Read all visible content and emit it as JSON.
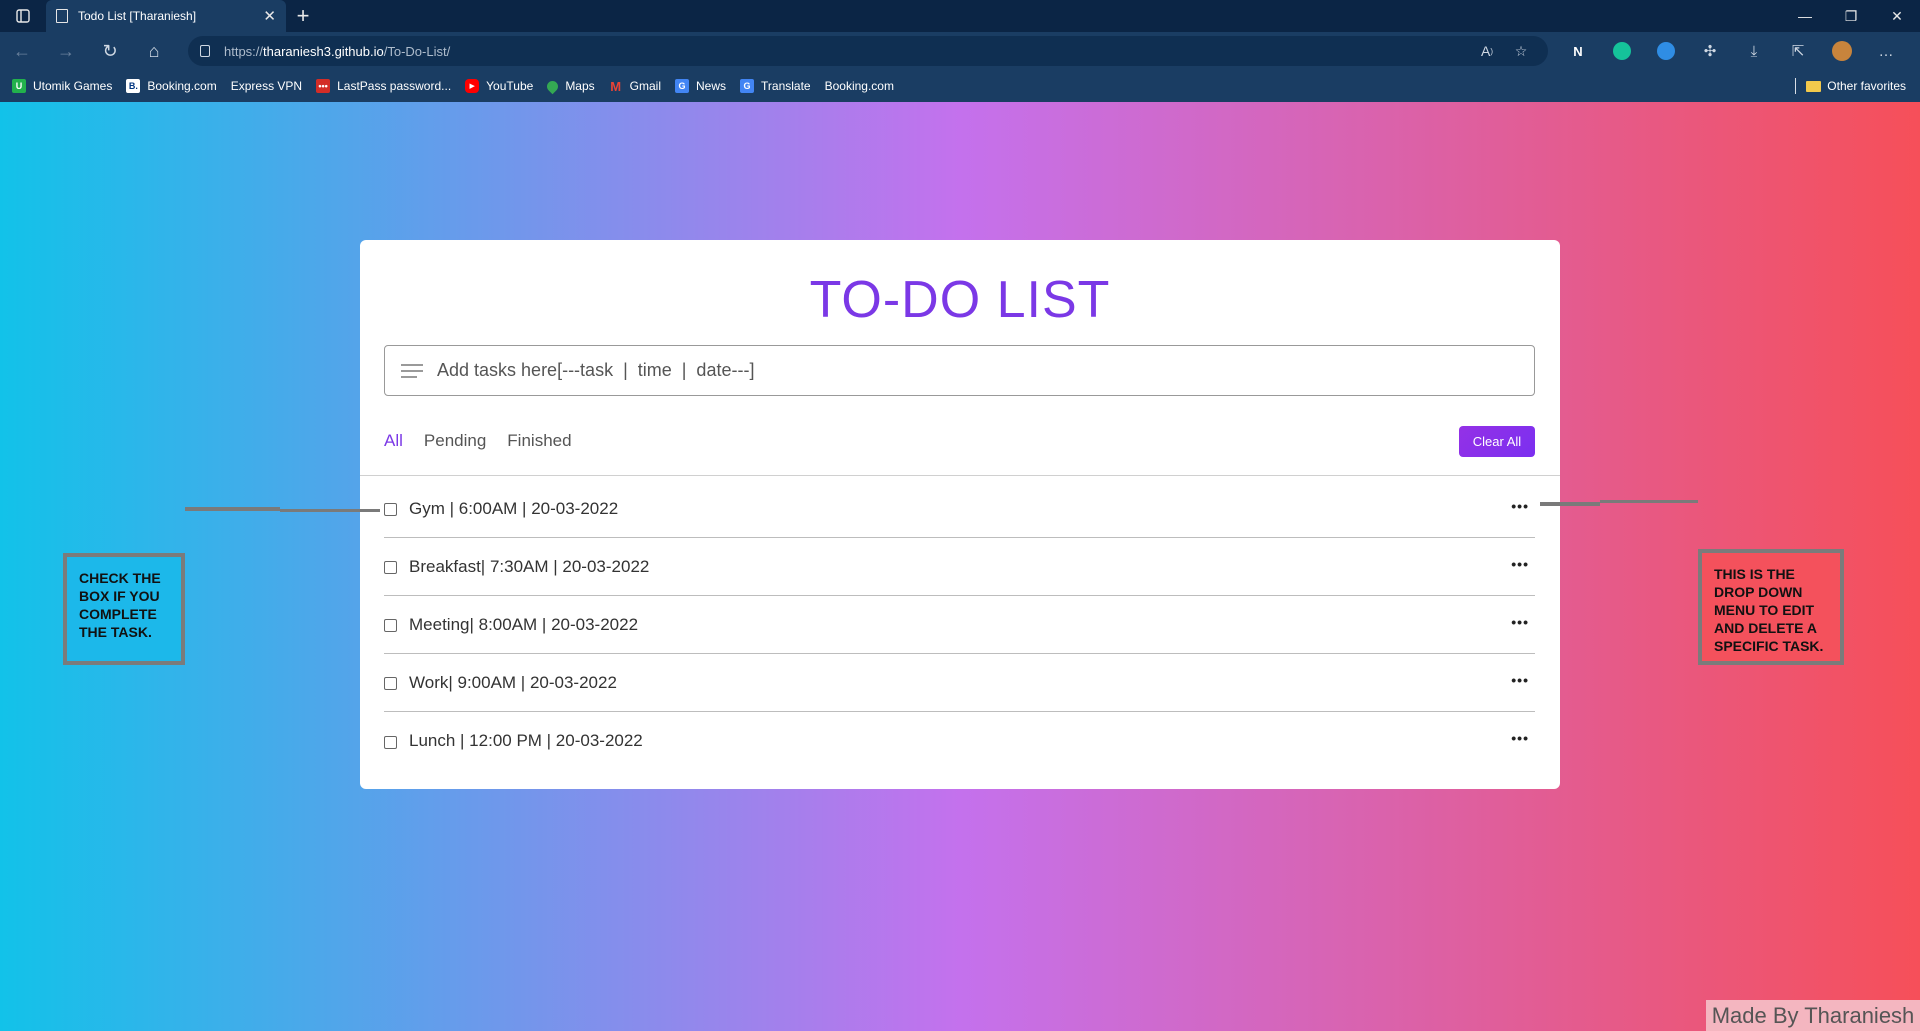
{
  "browser": {
    "tab_title": "Todo List [Tharaniesh]",
    "url_scheme": "https://",
    "url_host": "tharaniesh3.github.io",
    "url_path": "/To-Do-List/",
    "favorites": [
      {
        "label": "Utomik Games",
        "icon": "utomik-icon",
        "color": "#22b14c"
      },
      {
        "label": "Booking.com",
        "icon": "booking-icon",
        "color": "#003580"
      },
      {
        "label": "Express VPN",
        "icon": "page-icon",
        "color": ""
      },
      {
        "label": "LastPass password...",
        "icon": "lastpass-icon",
        "color": "#d32d27"
      },
      {
        "label": "YouTube",
        "icon": "youtube-icon",
        "color": "#ff0000"
      },
      {
        "label": "Maps",
        "icon": "maps-icon",
        "color": "#34a853"
      },
      {
        "label": "Gmail",
        "icon": "gmail-icon",
        "color": "#ea4335"
      },
      {
        "label": "News",
        "icon": "news-icon",
        "color": "#4285f4"
      },
      {
        "label": "Translate",
        "icon": "translate-icon",
        "color": "#4285f4"
      },
      {
        "label": "Booking.com",
        "icon": "page-icon",
        "color": ""
      }
    ],
    "other_favorites": "Other favorites"
  },
  "app": {
    "title": "TO-DO LIST",
    "input_placeholder": "Add tasks here[---task  |  time  |  date---]",
    "filters": [
      "All",
      "Pending",
      "Finished"
    ],
    "active_filter": "All",
    "clear_label": "Clear All",
    "accent_color": "#7b38e6",
    "tasks": [
      {
        "text": "Gym | 6:00AM | 20-03-2022",
        "completed": false
      },
      {
        "text": "Breakfast| 7:30AM | 20-03-2022",
        "completed": false
      },
      {
        "text": "Meeting| 8:00AM | 20-03-2022",
        "completed": false
      },
      {
        "text": "Work| 9:00AM | 20-03-2022",
        "completed": false
      },
      {
        "text": "Lunch | 12:00 PM | 20-03-2022",
        "completed": false
      }
    ]
  },
  "annotations": {
    "left": "CHECK THE BOX IF YOU COMPLETE THE TASK.",
    "right": "THIS IS THE DROP DOWN MENU TO EDIT AND DELETE A SPECIFIC TASK."
  },
  "watermark": "Made By Tharaniesh"
}
